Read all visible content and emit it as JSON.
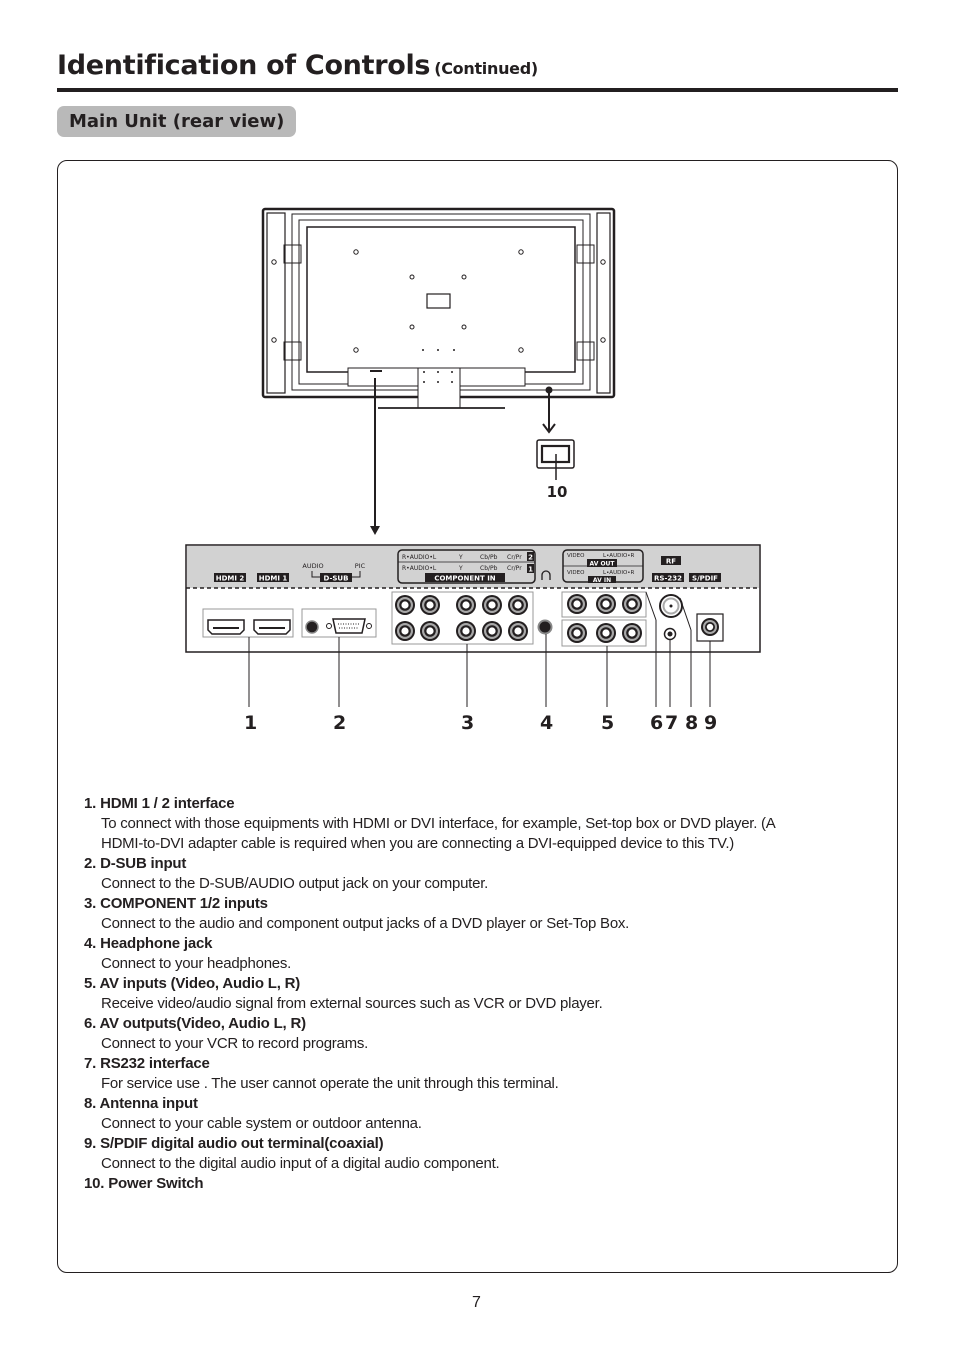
{
  "header": {
    "title": "Identification of Controls",
    "subtitle": "(Continued)",
    "section": "Main Unit (rear view)"
  },
  "diagram": {
    "power_switch_callout": "10",
    "panel_labels": {
      "hdmi2": "HDMI 2",
      "hdmi1": "HDMI 1",
      "audio": "AUDIO",
      "pic": "PIC",
      "dsub": "D-SUB",
      "component_row2": [
        "R•AUDIO•L",
        "Y",
        "Cb/Pb",
        "Cr/Pr",
        "2"
      ],
      "component_row1": [
        "R•AUDIO•L",
        "Y",
        "Cb/Pb",
        "Cr/Pr",
        "1"
      ],
      "component_in": "COMPONENT IN",
      "av_out_row": [
        "VIDEO",
        "L•AUDIO•R"
      ],
      "av_out": "AV OUT",
      "av_in_row": [
        "VIDEO",
        "L•AUDIO•R"
      ],
      "av_in": "AV IN",
      "rf": "RF",
      "rs232": "RS-232",
      "spdif": "S/PDIF"
    },
    "callouts": [
      "1",
      "2",
      "3",
      "4",
      "5",
      "6",
      "7",
      "8",
      "9"
    ]
  },
  "items": [
    {
      "title": "1. HDMI 1 / 2 interface",
      "desc": [
        "To connect with those equipments with HDMI or DVI interface, for example, Set-top box or DVD player. (A",
        "HDMI-to-DVI  adapter cable is required when you are connecting a DVI-equipped device to this TV.)"
      ]
    },
    {
      "title": "2. D-SUB input",
      "desc": [
        "Connect to the D-SUB/AUDIO output jack on your computer."
      ]
    },
    {
      "title": "3. COMPONENT 1/2 inputs",
      "desc": [
        "Connect to the audio and component output jacks of a DVD player or Set-Top Box."
      ]
    },
    {
      "title": "4. Headphone jack",
      "desc": [
        "Connect to your headphones."
      ]
    },
    {
      "title": "5. AV  inputs (Video, Audio L, R)",
      "desc": [
        "Receive video/audio signal from external sources such as VCR or DVD player."
      ]
    },
    {
      "title": "6. AV outputs(Video, Audio L, R)",
      "desc": [
        "Connect to your VCR to record programs."
      ]
    },
    {
      "title": "7. RS232 interface",
      "desc": [
        "For service use . The user cannot operate the unit through this terminal."
      ]
    },
    {
      "title": "8. Antenna input",
      "desc": [
        "Connect to your cable system or outdoor antenna."
      ]
    },
    {
      "title": "9. S/PDIF digital audio out terminal(coaxial)",
      "desc": [
        "Connect to the digital audio input of a digital audio component."
      ]
    },
    {
      "title": "10. Power Switch",
      "desc": []
    }
  ],
  "page_number": "7"
}
